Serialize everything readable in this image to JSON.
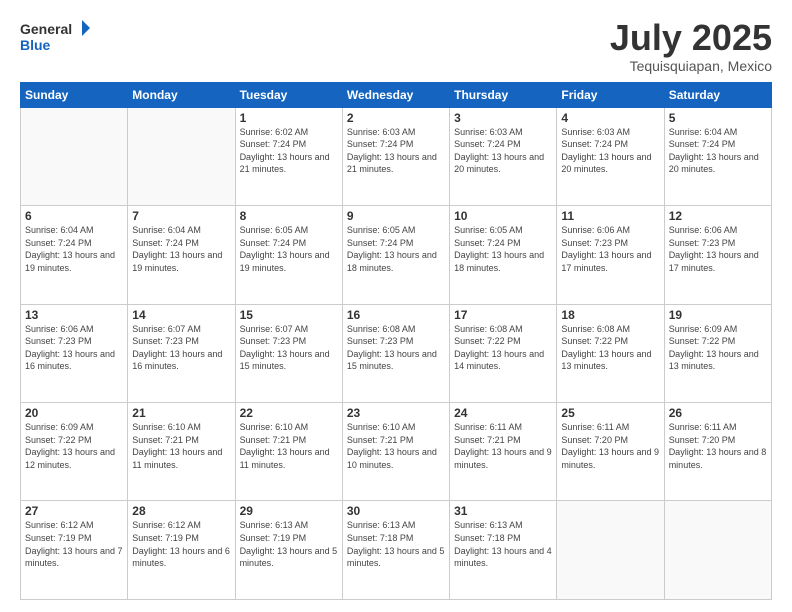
{
  "header": {
    "logo_general": "General",
    "logo_blue": "Blue",
    "month_title": "July 2025",
    "subtitle": "Tequisquiapan, Mexico"
  },
  "weekdays": [
    "Sunday",
    "Monday",
    "Tuesday",
    "Wednesday",
    "Thursday",
    "Friday",
    "Saturday"
  ],
  "weeks": [
    [
      {
        "day": "",
        "sunrise": "",
        "sunset": "",
        "daylight": ""
      },
      {
        "day": "",
        "sunrise": "",
        "sunset": "",
        "daylight": ""
      },
      {
        "day": "1",
        "sunrise": "Sunrise: 6:02 AM",
        "sunset": "Sunset: 7:24 PM",
        "daylight": "Daylight: 13 hours and 21 minutes."
      },
      {
        "day": "2",
        "sunrise": "Sunrise: 6:03 AM",
        "sunset": "Sunset: 7:24 PM",
        "daylight": "Daylight: 13 hours and 21 minutes."
      },
      {
        "day": "3",
        "sunrise": "Sunrise: 6:03 AM",
        "sunset": "Sunset: 7:24 PM",
        "daylight": "Daylight: 13 hours and 20 minutes."
      },
      {
        "day": "4",
        "sunrise": "Sunrise: 6:03 AM",
        "sunset": "Sunset: 7:24 PM",
        "daylight": "Daylight: 13 hours and 20 minutes."
      },
      {
        "day": "5",
        "sunrise": "Sunrise: 6:04 AM",
        "sunset": "Sunset: 7:24 PM",
        "daylight": "Daylight: 13 hours and 20 minutes."
      }
    ],
    [
      {
        "day": "6",
        "sunrise": "Sunrise: 6:04 AM",
        "sunset": "Sunset: 7:24 PM",
        "daylight": "Daylight: 13 hours and 19 minutes."
      },
      {
        "day": "7",
        "sunrise": "Sunrise: 6:04 AM",
        "sunset": "Sunset: 7:24 PM",
        "daylight": "Daylight: 13 hours and 19 minutes."
      },
      {
        "day": "8",
        "sunrise": "Sunrise: 6:05 AM",
        "sunset": "Sunset: 7:24 PM",
        "daylight": "Daylight: 13 hours and 19 minutes."
      },
      {
        "day": "9",
        "sunrise": "Sunrise: 6:05 AM",
        "sunset": "Sunset: 7:24 PM",
        "daylight": "Daylight: 13 hours and 18 minutes."
      },
      {
        "day": "10",
        "sunrise": "Sunrise: 6:05 AM",
        "sunset": "Sunset: 7:24 PM",
        "daylight": "Daylight: 13 hours and 18 minutes."
      },
      {
        "day": "11",
        "sunrise": "Sunrise: 6:06 AM",
        "sunset": "Sunset: 7:23 PM",
        "daylight": "Daylight: 13 hours and 17 minutes."
      },
      {
        "day": "12",
        "sunrise": "Sunrise: 6:06 AM",
        "sunset": "Sunset: 7:23 PM",
        "daylight": "Daylight: 13 hours and 17 minutes."
      }
    ],
    [
      {
        "day": "13",
        "sunrise": "Sunrise: 6:06 AM",
        "sunset": "Sunset: 7:23 PM",
        "daylight": "Daylight: 13 hours and 16 minutes."
      },
      {
        "day": "14",
        "sunrise": "Sunrise: 6:07 AM",
        "sunset": "Sunset: 7:23 PM",
        "daylight": "Daylight: 13 hours and 16 minutes."
      },
      {
        "day": "15",
        "sunrise": "Sunrise: 6:07 AM",
        "sunset": "Sunset: 7:23 PM",
        "daylight": "Daylight: 13 hours and 15 minutes."
      },
      {
        "day": "16",
        "sunrise": "Sunrise: 6:08 AM",
        "sunset": "Sunset: 7:23 PM",
        "daylight": "Daylight: 13 hours and 15 minutes."
      },
      {
        "day": "17",
        "sunrise": "Sunrise: 6:08 AM",
        "sunset": "Sunset: 7:22 PM",
        "daylight": "Daylight: 13 hours and 14 minutes."
      },
      {
        "day": "18",
        "sunrise": "Sunrise: 6:08 AM",
        "sunset": "Sunset: 7:22 PM",
        "daylight": "Daylight: 13 hours and 13 minutes."
      },
      {
        "day": "19",
        "sunrise": "Sunrise: 6:09 AM",
        "sunset": "Sunset: 7:22 PM",
        "daylight": "Daylight: 13 hours and 13 minutes."
      }
    ],
    [
      {
        "day": "20",
        "sunrise": "Sunrise: 6:09 AM",
        "sunset": "Sunset: 7:22 PM",
        "daylight": "Daylight: 13 hours and 12 minutes."
      },
      {
        "day": "21",
        "sunrise": "Sunrise: 6:10 AM",
        "sunset": "Sunset: 7:21 PM",
        "daylight": "Daylight: 13 hours and 11 minutes."
      },
      {
        "day": "22",
        "sunrise": "Sunrise: 6:10 AM",
        "sunset": "Sunset: 7:21 PM",
        "daylight": "Daylight: 13 hours and 11 minutes."
      },
      {
        "day": "23",
        "sunrise": "Sunrise: 6:10 AM",
        "sunset": "Sunset: 7:21 PM",
        "daylight": "Daylight: 13 hours and 10 minutes."
      },
      {
        "day": "24",
        "sunrise": "Sunrise: 6:11 AM",
        "sunset": "Sunset: 7:21 PM",
        "daylight": "Daylight: 13 hours and 9 minutes."
      },
      {
        "day": "25",
        "sunrise": "Sunrise: 6:11 AM",
        "sunset": "Sunset: 7:20 PM",
        "daylight": "Daylight: 13 hours and 9 minutes."
      },
      {
        "day": "26",
        "sunrise": "Sunrise: 6:11 AM",
        "sunset": "Sunset: 7:20 PM",
        "daylight": "Daylight: 13 hours and 8 minutes."
      }
    ],
    [
      {
        "day": "27",
        "sunrise": "Sunrise: 6:12 AM",
        "sunset": "Sunset: 7:19 PM",
        "daylight": "Daylight: 13 hours and 7 minutes."
      },
      {
        "day": "28",
        "sunrise": "Sunrise: 6:12 AM",
        "sunset": "Sunset: 7:19 PM",
        "daylight": "Daylight: 13 hours and 6 minutes."
      },
      {
        "day": "29",
        "sunrise": "Sunrise: 6:13 AM",
        "sunset": "Sunset: 7:19 PM",
        "daylight": "Daylight: 13 hours and 5 minutes."
      },
      {
        "day": "30",
        "sunrise": "Sunrise: 6:13 AM",
        "sunset": "Sunset: 7:18 PM",
        "daylight": "Daylight: 13 hours and 5 minutes."
      },
      {
        "day": "31",
        "sunrise": "Sunrise: 6:13 AM",
        "sunset": "Sunset: 7:18 PM",
        "daylight": "Daylight: 13 hours and 4 minutes."
      },
      {
        "day": "",
        "sunrise": "",
        "sunset": "",
        "daylight": ""
      },
      {
        "day": "",
        "sunrise": "",
        "sunset": "",
        "daylight": ""
      }
    ]
  ]
}
